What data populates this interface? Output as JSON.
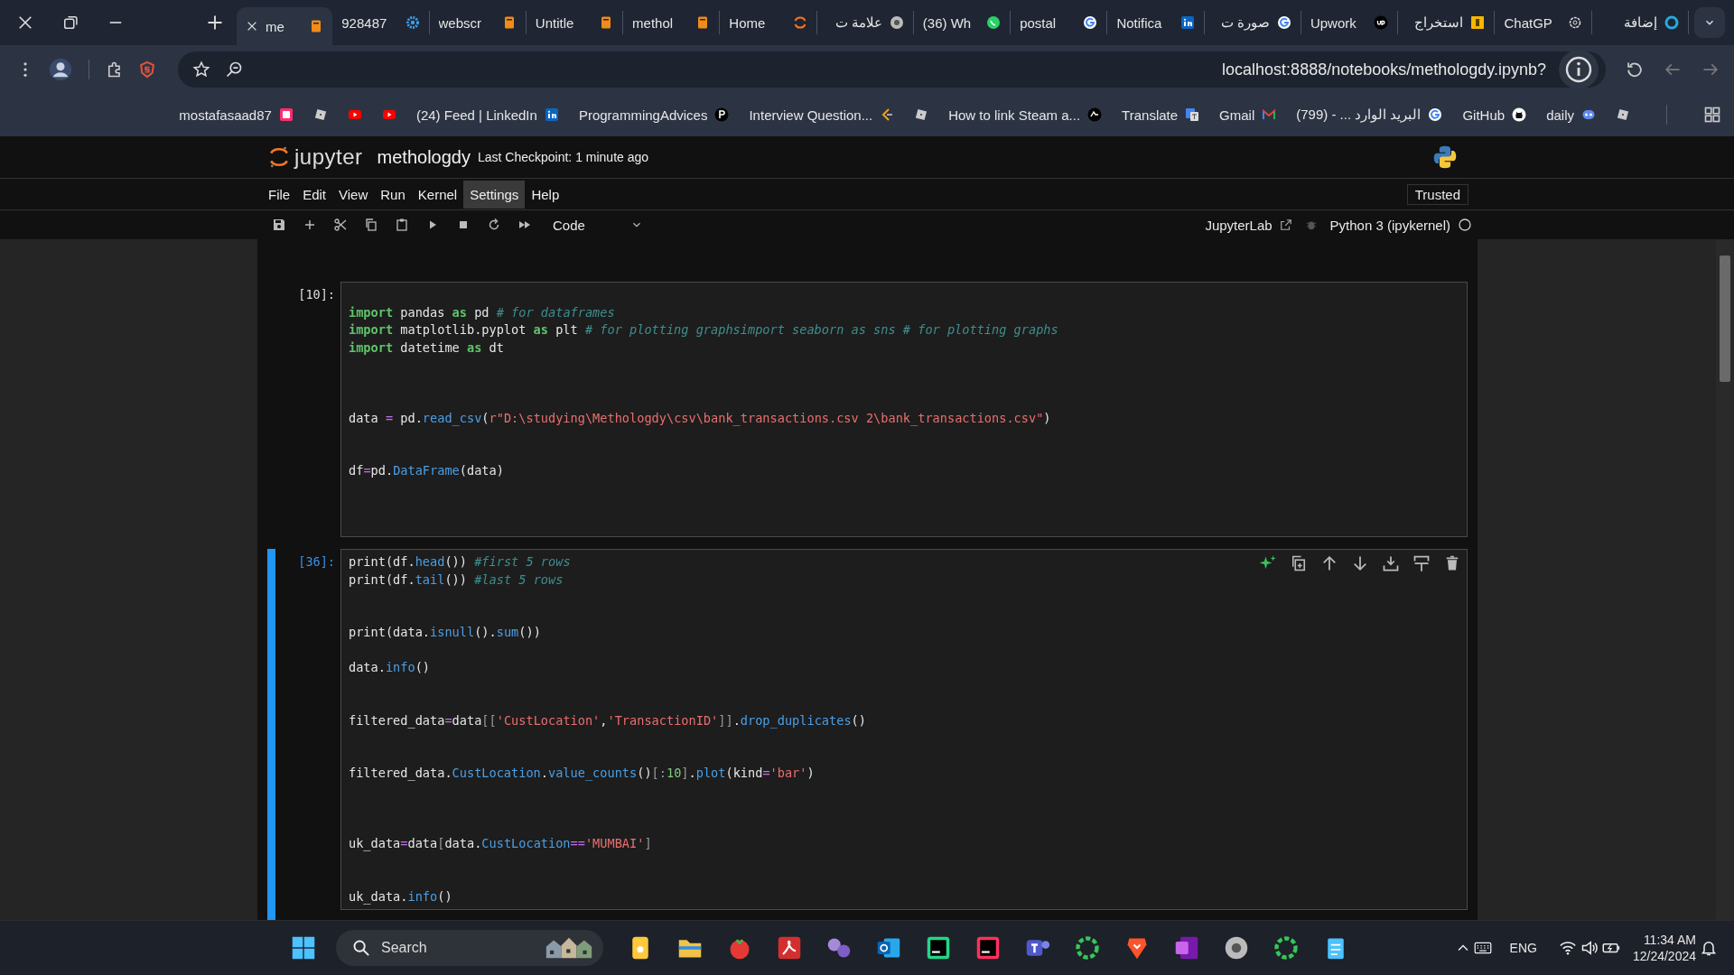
{
  "tabs": [
    {
      "title": "me",
      "kind": "notebook",
      "selected": true
    },
    {
      "title": "928487",
      "kind": "gear",
      "selected": false
    },
    {
      "title": "webscr",
      "kind": "notebook",
      "selected": false
    },
    {
      "title": "Untitle",
      "kind": "notebook",
      "selected": false
    },
    {
      "title": "methol",
      "kind": "notebook",
      "selected": false
    },
    {
      "title": "Home",
      "kind": "spinner",
      "selected": false
    },
    {
      "title": "علامة ت",
      "kind": "chrome",
      "selected": false
    },
    {
      "title": "(36) Wh",
      "kind": "whatsapp",
      "selected": false
    },
    {
      "title": "postal",
      "kind": "google",
      "selected": false
    },
    {
      "title": "Notifica",
      "kind": "linkedin",
      "selected": false
    },
    {
      "title": "صورة ت",
      "kind": "google",
      "selected": false
    },
    {
      "title": "Upwork",
      "kind": "upwork",
      "selected": false
    },
    {
      "title": "استخراج",
      "kind": "badge",
      "selected": false
    },
    {
      "title": "ChatGP",
      "kind": "openai",
      "selected": false
    },
    {
      "title": "إضافة",
      "kind": "ring",
      "selected": false
    }
  ],
  "address": {
    "url": "localhost:8888/notebooks/methologdy.ipynb?"
  },
  "bookmarks": [
    {
      "label": "mostafasaad87",
      "kind": "pinkbox"
    },
    {
      "kind": "blocky"
    },
    {
      "kind": "youtube"
    },
    {
      "kind": "youtube"
    },
    {
      "label": "(24) Feed | LinkedIn",
      "kind": "linkedin"
    },
    {
      "label": "ProgrammingAdvices",
      "kind": "p"
    },
    {
      "label": "Interview Question...",
      "kind": "leet"
    },
    {
      "kind": "blocky"
    },
    {
      "label": "How to link Steam a...",
      "kind": "ea"
    },
    {
      "label": "Translate",
      "kind": "translate"
    },
    {
      "label": "Gmail",
      "kind": "gmail"
    },
    {
      "label": "البريد الوارد ... - (799)",
      "kind": "google"
    },
    {
      "label": "GitHub",
      "kind": "github"
    },
    {
      "label": "daily",
      "kind": "daily"
    },
    {
      "kind": "blocky"
    }
  ],
  "jupyter": {
    "logo": "jupyter",
    "notebook": "methologdy",
    "checkpoint": "Last Checkpoint: 1 minute ago",
    "menu": [
      {
        "label": "File",
        "selected": false
      },
      {
        "label": "Edit",
        "selected": false
      },
      {
        "label": "View",
        "selected": false
      },
      {
        "label": "Run",
        "selected": false
      },
      {
        "label": "Kernel",
        "selected": false
      },
      {
        "label": "Settings",
        "selected": true
      },
      {
        "label": "Help",
        "selected": false
      }
    ],
    "trusted": "Trusted",
    "cell_type": "Code",
    "jupyterlab": "JupyterLab",
    "kernel": "Python 3 (ipykernel)",
    "kernel_busy": false
  },
  "cells": [
    {
      "prompt": "[10]:",
      "selected": false,
      "lines": [
        {
          "kind": "blank"
        },
        {
          "kind": "code",
          "tokens": [
            {
              "kind": "keyword",
              "text": "import"
            },
            {
              "kind": "plain",
              "text": " pandas "
            },
            {
              "kind": "keyword",
              "text": "as"
            },
            {
              "kind": "plain",
              "text": " pd "
            },
            {
              "kind": "comment",
              "text": "# for dataframes"
            }
          ]
        },
        {
          "kind": "code",
          "tokens": [
            {
              "kind": "keyword",
              "text": "import"
            },
            {
              "kind": "plain",
              "text": " matplotlib.pyplot "
            },
            {
              "kind": "keyword",
              "text": "as"
            },
            {
              "kind": "plain",
              "text": " plt "
            },
            {
              "kind": "comment",
              "text": "# for plotting graphsimport seaborn as sns # for plotting graphs"
            }
          ]
        },
        {
          "kind": "code",
          "tokens": [
            {
              "kind": "keyword",
              "text": "import"
            },
            {
              "kind": "plain",
              "text": " datetime "
            },
            {
              "kind": "keyword",
              "text": "as"
            },
            {
              "kind": "plain",
              "text": " dt"
            }
          ]
        },
        {
          "kind": "blank"
        },
        {
          "kind": "blank"
        },
        {
          "kind": "blank"
        },
        {
          "kind": "code",
          "tokens": [
            {
              "kind": "plain",
              "text": "data "
            },
            {
              "kind": "operator",
              "text": "="
            },
            {
              "kind": "plain",
              "text": " pd."
            },
            {
              "kind": "function",
              "text": "read_csv"
            },
            {
              "kind": "plain",
              "text": "("
            },
            {
              "kind": "string",
              "text": "r\"D:\\studying\\Methologdy\\csv\\bank_transactions.csv 2\\bank_transactions.csv\""
            },
            {
              "kind": "plain",
              "text": ")"
            }
          ]
        },
        {
          "kind": "blank"
        },
        {
          "kind": "blank"
        },
        {
          "kind": "code",
          "tokens": [
            {
              "kind": "plain",
              "text": "df"
            },
            {
              "kind": "operator",
              "text": "="
            },
            {
              "kind": "plain",
              "text": "pd."
            },
            {
              "kind": "function",
              "text": "DataFrame"
            },
            {
              "kind": "plain",
              "text": "(data)"
            }
          ]
        },
        {
          "kind": "blank"
        },
        {
          "kind": "blank"
        },
        {
          "kind": "blank"
        }
      ]
    },
    {
      "prompt": "[36]:",
      "selected": true,
      "lines": [
        {
          "kind": "code",
          "tokens": [
            {
              "kind": "plain",
              "text": "print(df."
            },
            {
              "kind": "function",
              "text": "head"
            },
            {
              "kind": "plain",
              "text": "()) "
            },
            {
              "kind": "comment",
              "text": "#first 5 rows"
            }
          ]
        },
        {
          "kind": "code",
          "tokens": [
            {
              "kind": "plain",
              "text": "print(df."
            },
            {
              "kind": "function",
              "text": "tail"
            },
            {
              "kind": "plain",
              "text": "()) "
            },
            {
              "kind": "comment",
              "text": "#last 5 rows"
            }
          ]
        },
        {
          "kind": "blank"
        },
        {
          "kind": "blank"
        },
        {
          "kind": "code",
          "tokens": [
            {
              "kind": "plain",
              "text": "print(data."
            },
            {
              "kind": "function",
              "text": "isnull"
            },
            {
              "kind": "plain",
              "text": "()."
            },
            {
              "kind": "function",
              "text": "sum"
            },
            {
              "kind": "plain",
              "text": "())"
            }
          ]
        },
        {
          "kind": "blank"
        },
        {
          "kind": "code",
          "tokens": [
            {
              "kind": "plain",
              "text": "data."
            },
            {
              "kind": "function",
              "text": "info"
            },
            {
              "kind": "plain",
              "text": "()"
            }
          ]
        },
        {
          "kind": "blank"
        },
        {
          "kind": "blank"
        },
        {
          "kind": "code",
          "tokens": [
            {
              "kind": "plain",
              "text": "filtered_data"
            },
            {
              "kind": "operator",
              "text": "="
            },
            {
              "kind": "plain",
              "text": "data"
            },
            {
              "kind": "bracket",
              "text": "[["
            },
            {
              "kind": "string",
              "text": "'CustLocation'"
            },
            {
              "kind": "plain",
              "text": ","
            },
            {
              "kind": "string",
              "text": "'TransactionID'"
            },
            {
              "kind": "bracket",
              "text": "]]"
            },
            {
              "kind": "plain",
              "text": "."
            },
            {
              "kind": "function",
              "text": "drop_duplicates"
            },
            {
              "kind": "plain",
              "text": "()"
            }
          ]
        },
        {
          "kind": "blank"
        },
        {
          "kind": "blank"
        },
        {
          "kind": "code",
          "tokens": [
            {
              "kind": "plain",
              "text": "filtered_data."
            },
            {
              "kind": "function",
              "text": "CustLocation"
            },
            {
              "kind": "plain",
              "text": "."
            },
            {
              "kind": "function",
              "text": "value_counts"
            },
            {
              "kind": "plain",
              "text": "()"
            },
            {
              "kind": "bracket",
              "text": "[:"
            },
            {
              "kind": "number",
              "text": "10"
            },
            {
              "kind": "bracket",
              "text": "]"
            },
            {
              "kind": "plain",
              "text": "."
            },
            {
              "kind": "function",
              "text": "plot"
            },
            {
              "kind": "plain",
              "text": "(kind"
            },
            {
              "kind": "operator",
              "text": "="
            },
            {
              "kind": "string",
              "text": "'bar'"
            },
            {
              "kind": "plain",
              "text": ")"
            }
          ]
        },
        {
          "kind": "blank"
        },
        {
          "kind": "blank"
        },
        {
          "kind": "blank"
        },
        {
          "kind": "code",
          "tokens": [
            {
              "kind": "plain",
              "text": "uk_data"
            },
            {
              "kind": "operator",
              "text": "="
            },
            {
              "kind": "plain",
              "text": "data"
            },
            {
              "kind": "bracket",
              "text": "["
            },
            {
              "kind": "plain",
              "text": "data."
            },
            {
              "kind": "function",
              "text": "CustLocation"
            },
            {
              "kind": "operator",
              "text": "=="
            },
            {
              "kind": "string",
              "text": "'MUMBAI'"
            },
            {
              "kind": "bracket",
              "text": "]"
            }
          ]
        },
        {
          "kind": "blank"
        },
        {
          "kind": "blank"
        },
        {
          "kind": "code",
          "tokens": [
            {
              "kind": "plain",
              "text": "uk_data."
            },
            {
              "kind": "function",
              "text": "info"
            },
            {
              "kind": "plain",
              "text": "()"
            }
          ]
        }
      ]
    }
  ],
  "taskbar": {
    "search": "Search",
    "apps": [
      {
        "kind": "note"
      },
      {
        "kind": "folder"
      },
      {
        "kind": "tomato"
      },
      {
        "kind": "pdf"
      },
      {
        "kind": "blobs"
      },
      {
        "kind": "mail"
      },
      {
        "kind": "cl"
      },
      {
        "kind": "ij"
      },
      {
        "kind": "teams"
      },
      {
        "kind": "greenring"
      },
      {
        "kind": "brave"
      },
      {
        "kind": "onenote"
      },
      {
        "kind": "chrome"
      },
      {
        "kind": "greenring"
      },
      {
        "kind": "notepad"
      }
    ],
    "language": "ENG",
    "time": "11:34 AM",
    "date": "12/24/2024"
  }
}
